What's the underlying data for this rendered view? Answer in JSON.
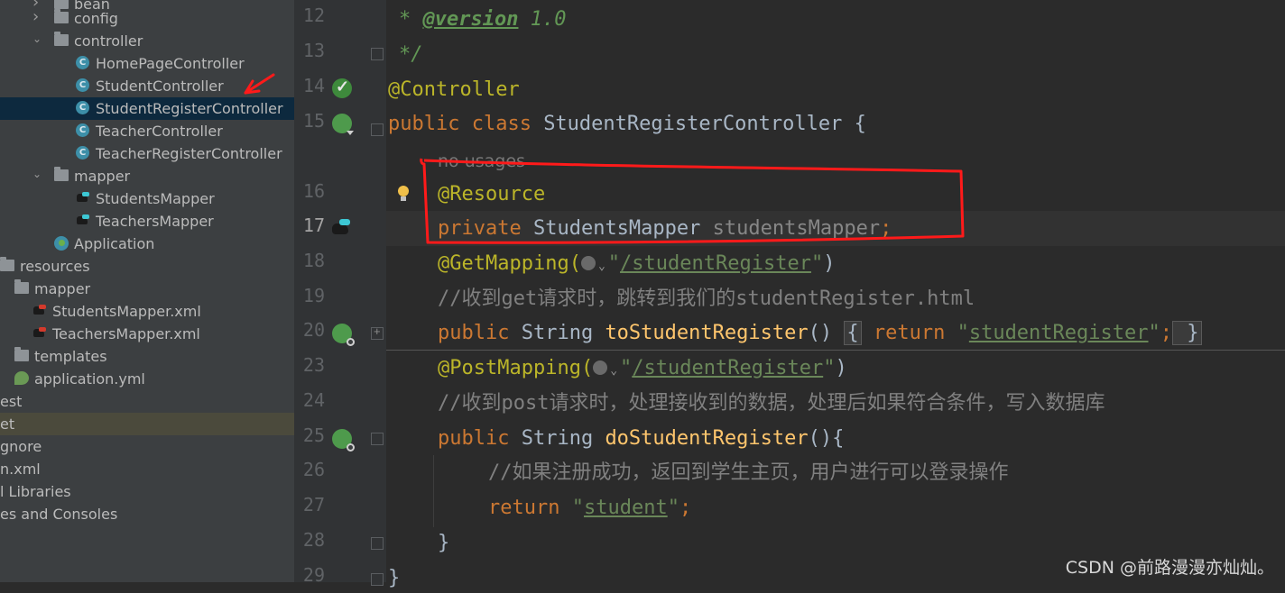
{
  "project_tree": [
    {
      "label": "bean",
      "indent": 60,
      "type": "folder",
      "state": "collapsed"
    },
    {
      "label": "config",
      "indent": 60,
      "type": "folder",
      "state": "collapsed"
    },
    {
      "label": "controller",
      "indent": 60,
      "type": "folder",
      "state": "expanded"
    },
    {
      "label": "HomePageController",
      "indent": 84,
      "type": "class"
    },
    {
      "label": "StudentController",
      "indent": 84,
      "type": "class"
    },
    {
      "label": "StudentRegisterController",
      "indent": 84,
      "type": "class",
      "selected": true
    },
    {
      "label": "TeacherController",
      "indent": 84,
      "type": "class"
    },
    {
      "label": "TeacherRegisterController",
      "indent": 84,
      "type": "class"
    },
    {
      "label": "mapper",
      "indent": 60,
      "type": "folder",
      "state": "expanded"
    },
    {
      "label": "StudentsMapper",
      "indent": 84,
      "type": "mapper"
    },
    {
      "label": "TeachersMapper",
      "indent": 84,
      "type": "mapper"
    },
    {
      "label": "Application",
      "indent": 60,
      "type": "app"
    },
    {
      "label": "resources",
      "indent": 0,
      "type": "folder",
      "state": "expanded"
    },
    {
      "label": "mapper",
      "indent": 16,
      "type": "folder",
      "state": "expanded"
    },
    {
      "label": "StudentsMapper.xml",
      "indent": 36,
      "type": "xml"
    },
    {
      "label": "TeachersMapper.xml",
      "indent": 36,
      "type": "xml"
    },
    {
      "label": "templates",
      "indent": 16,
      "type": "folder",
      "state": "collapsed"
    },
    {
      "label": "application.yml",
      "indent": 16,
      "type": "yml"
    },
    {
      "label": "est",
      "indent": 0,
      "type": "text"
    },
    {
      "label": "et",
      "indent": 0,
      "type": "text",
      "highlight": true
    },
    {
      "label": "gnore",
      "indent": 0,
      "type": "text"
    },
    {
      "label": "n.xml",
      "indent": 0,
      "type": "text"
    },
    {
      "label": "l Libraries",
      "indent": 0,
      "type": "text"
    },
    {
      "label": "es and Consoles",
      "indent": 0,
      "type": "text"
    }
  ],
  "editor": {
    "line_numbers": [
      "12",
      "13",
      "14",
      "15",
      "16",
      "17",
      "18",
      "19",
      "20",
      "23",
      "24",
      "25",
      "26",
      "27",
      "28",
      "29"
    ],
    "code": {
      "l12_star": "* ",
      "l12_tag": "@version",
      "l12_val": " 1.0",
      "l13": "*/",
      "l14": "@Controller",
      "l15_kw": "public class ",
      "l15_name": "StudentRegisterController ",
      "l15_brace": "{",
      "hint": "no usages",
      "l16": "@Resource",
      "l17_kw": "private ",
      "l17_type": "StudentsMapper ",
      "l17_field": "studentsMapper",
      "l17_semi": ";",
      "l18_ann": "@GetMapping(",
      "l18_q1": "\"",
      "l18_path": "/studentRegister",
      "l18_q2": "\"",
      "l18_close": ")",
      "l19": "//收到get请求时，跳转到我们的studentRegister.html",
      "l20_kw": "public ",
      "l20_type": "String ",
      "l20_fn": "toStudentRegister",
      "l20_parens": "() ",
      "l20_lb": "{",
      "l20_ret": " return ",
      "l20_q1": "\"",
      "l20_str": "studentRegister",
      "l20_q2": "\"",
      "l20_semi": ";",
      "l20_rb": " }",
      "l23_ann": "@PostMapping(",
      "l23_q1": "\"",
      "l23_path": "/studentRegister",
      "l23_q2": "\"",
      "l23_close": ")",
      "l24": "//收到post请求时，处理接收到的数据，处理后如果符合条件，写入数据库",
      "l25_kw": "public ",
      "l25_type": "String ",
      "l25_fn": "doStudentRegister",
      "l25_rest": "(){",
      "l26": "//如果注册成功，返回到学生主页，用户进行可以登录操作",
      "l27_kw": "return ",
      "l27_q1": "\"",
      "l27_str": "student",
      "l27_q2": "\"",
      "l27_semi": ";",
      "l28": "}",
      "l29": "}"
    },
    "chevron": "⌄"
  },
  "watermark": "CSDN @前路漫漫亦灿灿。",
  "colors": {
    "keyword": "#cc7832",
    "annotation": "#bbb529",
    "string": "#6a8759",
    "comment": "#808080",
    "function": "#ffc66d",
    "annotation_markup": "#ff0000"
  }
}
